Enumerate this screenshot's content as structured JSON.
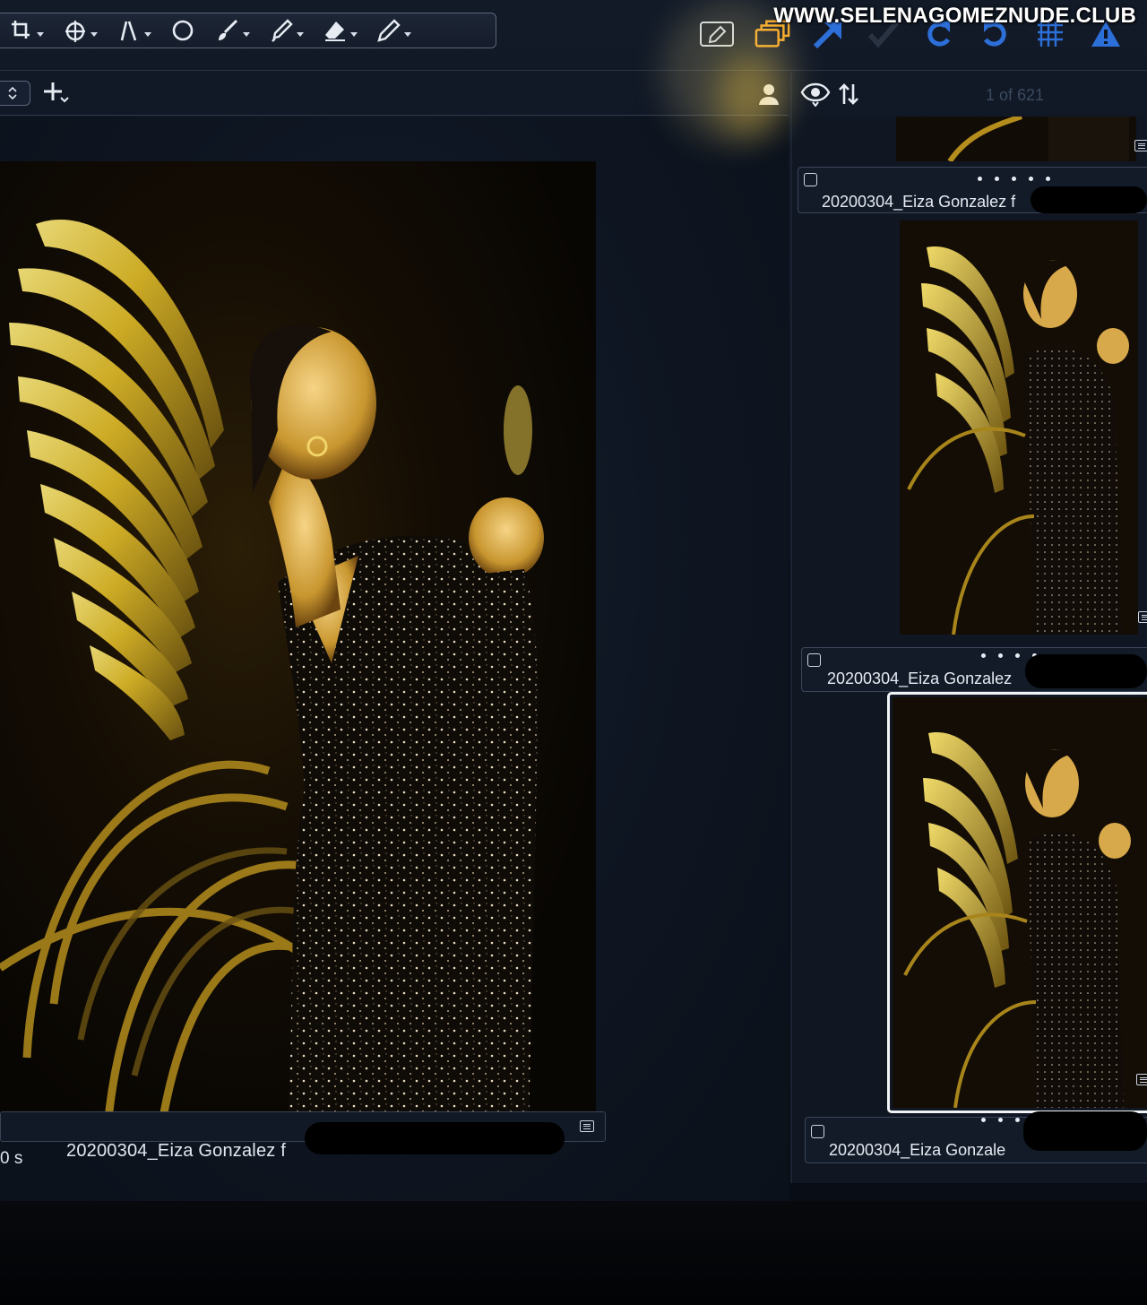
{
  "watermark": "WWW.SELENAGOMEZNUDE.CLUB",
  "toolbar": {
    "tools": [
      {
        "icon": "crop-icon"
      },
      {
        "icon": "rotate-icon"
      },
      {
        "icon": "straighten-icon"
      },
      {
        "icon": "circle-mask-icon"
      },
      {
        "icon": "brush-icon"
      },
      {
        "icon": "color-picker-icon"
      },
      {
        "icon": "eraser-icon"
      },
      {
        "icon": "pen-icon"
      }
    ],
    "right": [
      {
        "icon": "edit-icon"
      },
      {
        "icon": "variants-icon"
      },
      {
        "icon": "apply-arrow-icon"
      },
      {
        "icon": "check-icon"
      },
      {
        "icon": "undo-icon"
      },
      {
        "icon": "redo-icon"
      },
      {
        "icon": "grid-icon"
      },
      {
        "icon": "warning-icon"
      }
    ]
  },
  "browser": {
    "counter": "1 of 621",
    "thumbnails": [
      {
        "filename": "20200304_Eiza Gonzalez f"
      },
      {
        "filename": "20200304_Eiza Gonzalez"
      },
      {
        "filename": "20200304_Eiza Gonzale"
      }
    ]
  },
  "viewer": {
    "time": "0 s",
    "filename": "20200304_Eiza Gonzalez f"
  },
  "colors": {
    "accent_orange": "#f5a623",
    "ui_blue": "#2d6fd8",
    "background": "#0e1521",
    "gold": "#c8a21a"
  }
}
